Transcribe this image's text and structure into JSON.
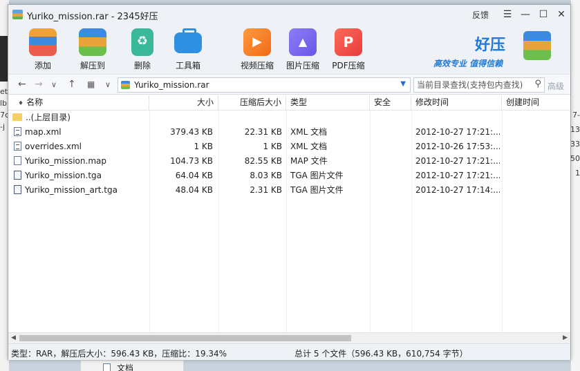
{
  "window": {
    "title": "Yuriko_mission.rar - 2345好压",
    "feedback_label": "反馈",
    "minimize_glyph": "—",
    "maximize_glyph": "☐",
    "close_glyph": "✕"
  },
  "toolbar": {
    "items": [
      {
        "label": "添加",
        "icon": "add-archive-icon"
      },
      {
        "label": "解压到",
        "icon": "extract-icon"
      },
      {
        "label": "删除",
        "icon": "recycle-icon"
      },
      {
        "label": "工具箱",
        "icon": "toolbox-icon"
      },
      {
        "label": "视频压缩",
        "icon": "video-icon"
      },
      {
        "label": "图片压缩",
        "icon": "image-icon"
      },
      {
        "label": "PDF压缩",
        "icon": "pdf-icon"
      }
    ],
    "brand_name": "好压",
    "brand_tagline": "高效专业  值得信赖"
  },
  "addressbar": {
    "path": "Yuriko_mission.rar",
    "search_placeholder": "当前目录查找(支持包内查找)",
    "filter_label": "高级"
  },
  "columns": [
    "名称",
    "大小",
    "压缩后大小",
    "类型",
    "安全",
    "修改时间",
    "创建时间"
  ],
  "files": [
    {
      "name": "..(上层目录)",
      "size": "",
      "packed": "",
      "type": "",
      "modified": "",
      "kind": "folder"
    },
    {
      "name": "map.xml",
      "size": "379.43 KB",
      "packed": "22.31 KB",
      "type": "XML 文档",
      "modified": "2012-10-27 17:21:...",
      "kind": "xml"
    },
    {
      "name": "overrides.xml",
      "size": "1 KB",
      "packed": "1 KB",
      "type": "XML 文档",
      "modified": "2012-10-26 17:53:...",
      "kind": "xml"
    },
    {
      "name": "Yuriko_mission.map",
      "size": "104.73 KB",
      "packed": "82.55 KB",
      "type": "MAP 文件",
      "modified": "2012-10-27 17:21:...",
      "kind": "file"
    },
    {
      "name": "Yuriko_mission.tga",
      "size": "64.04 KB",
      "packed": "8.03 KB",
      "type": "TGA 图片文件",
      "modified": "2012-10-27 17:21:...",
      "kind": "img"
    },
    {
      "name": "Yuriko_mission_art.tga",
      "size": "48.04 KB",
      "packed": "2.31 KB",
      "type": "TGA 图片文件",
      "modified": "2012-10-27 17:14:...",
      "kind": "img"
    }
  ],
  "status": {
    "left": "类型：RAR，解压后大小：596.43 KB，压缩比：19.34%",
    "right": "总计 5 个文件（596.43 KB，610,754 字节）"
  },
  "background": {
    "left_fragments": [
      "et",
      "lb",
      "7c",
      "-j"
    ],
    "right_fragments": [
      "7-",
      "13",
      "33",
      "50",
      "1"
    ],
    "taskbar_item": "文档"
  }
}
